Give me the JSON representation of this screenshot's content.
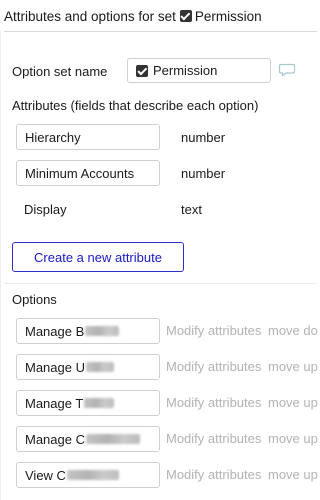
{
  "header": {
    "title": "Attributes and options for set",
    "set_name": "Permission",
    "set_icon": "checkbox-checked-icon"
  },
  "option_set": {
    "label": "Option set name",
    "value": "Permission",
    "value_icon": "checkbox-checked-icon",
    "comment_icon": "comment-icon"
  },
  "attributes": {
    "heading": "Attributes (fields that describe each option)",
    "items": [
      {
        "name": "Hierarchy",
        "type": "number",
        "editable": true
      },
      {
        "name": "Minimum Accounts",
        "type": "number",
        "editable": true
      },
      {
        "name": "Display",
        "type": "text",
        "editable": false
      }
    ],
    "create_button_label": "Create a new attribute"
  },
  "options": {
    "heading": "Options",
    "items": [
      {
        "visible_text": "Manage B",
        "move_label": "move do"
      },
      {
        "visible_text": "Manage U",
        "move_label": "move up"
      },
      {
        "visible_text": "Manage T",
        "move_label": "move up"
      },
      {
        "visible_text": "Manage C",
        "move_label": "move up"
      },
      {
        "visible_text": "View C",
        "move_label": "move up"
      }
    ],
    "modify_label": "Modify attributes"
  },
  "colors": {
    "accent": "#1a1acc",
    "muted_link": "#b3b3b3",
    "field_border": "#cfcfcf"
  }
}
